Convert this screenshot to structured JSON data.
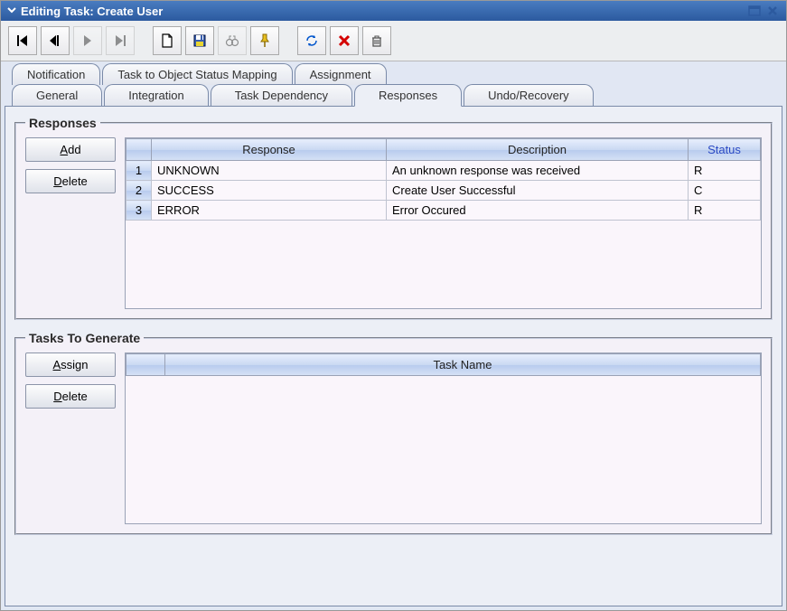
{
  "window": {
    "title": "Editing Task: Create User"
  },
  "toolbar": {
    "first": "First",
    "back": "Back",
    "forward": "Forward",
    "last": "Last",
    "new": "New",
    "save": "Save",
    "search": "Search",
    "pin": "Pin",
    "refresh": "Refresh",
    "delete": "Delete",
    "trash": "Trash"
  },
  "tabs_row1": [
    {
      "label": "Notification"
    },
    {
      "label": "Task to Object Status Mapping"
    },
    {
      "label": "Assignment"
    }
  ],
  "tabs_row2": [
    {
      "label": "General"
    },
    {
      "label": "Integration"
    },
    {
      "label": "Task Dependency"
    },
    {
      "label": "Responses",
      "active": true
    },
    {
      "label": "Undo/Recovery"
    }
  ],
  "responses": {
    "legend": "Responses",
    "buttons": {
      "add": "Add",
      "delete": "Delete"
    },
    "columns": {
      "response": "Response",
      "description": "Description",
      "status": "Status"
    },
    "rows": [
      {
        "n": "1",
        "response": "UNKNOWN",
        "description": "An unknown response was received",
        "status": "R"
      },
      {
        "n": "2",
        "response": "SUCCESS",
        "description": "Create User Successful",
        "status": "C"
      },
      {
        "n": "3",
        "response": "ERROR",
        "description": "Error Occured",
        "status": "R"
      }
    ]
  },
  "tasks": {
    "legend": "Tasks To Generate",
    "buttons": {
      "assign": "Assign",
      "delete": "Delete"
    },
    "columns": {
      "taskname": "Task Name"
    },
    "rows": []
  }
}
